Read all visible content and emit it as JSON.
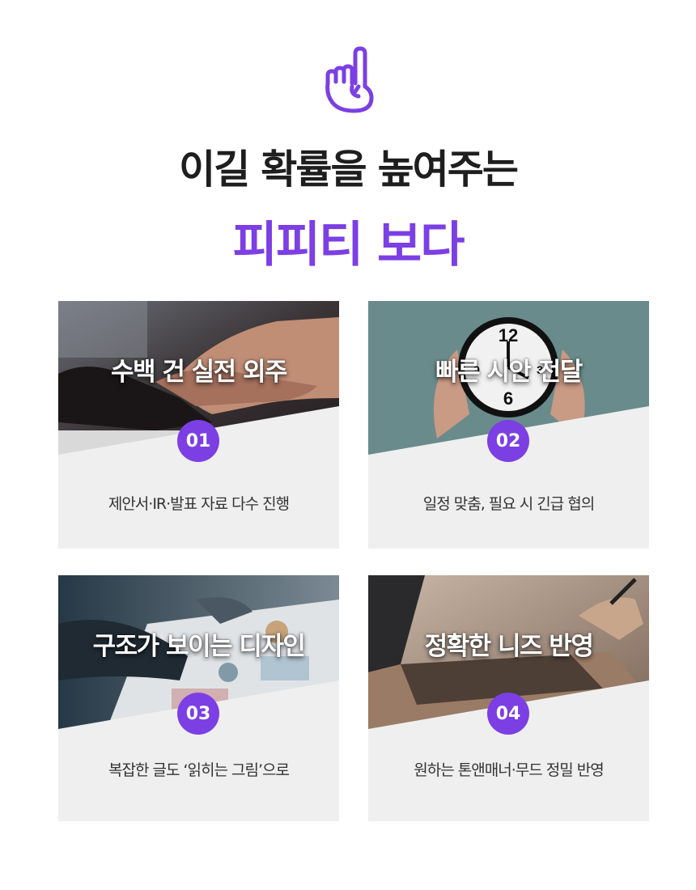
{
  "header": {
    "icon": "pointing-hand-icon",
    "line1": "이길 확률을 높여주는",
    "line2": "피피티 보다",
    "accent": "#7b3fe4"
  },
  "cards": [
    {
      "title": "수백 건 실전 외주",
      "number": "01",
      "description": "제안서·IR·발표 자료 다수 진행",
      "photo": "handshake"
    },
    {
      "title": "빠른 시안 전달",
      "number": "02",
      "description": "일정 맞춤, 필요 시 긴급 협의",
      "photo": "clock-in-hands"
    },
    {
      "title": "구조가 보이는 디자인",
      "number": "03",
      "description": "복잡한 글도 ‘읽히는 그림’으로",
      "photo": "documents-on-desk"
    },
    {
      "title": "정확한 니즈 반영",
      "number": "04",
      "description": "원하는 톤앤매너·무드 정밀 반영",
      "photo": "laptop-typing"
    }
  ]
}
